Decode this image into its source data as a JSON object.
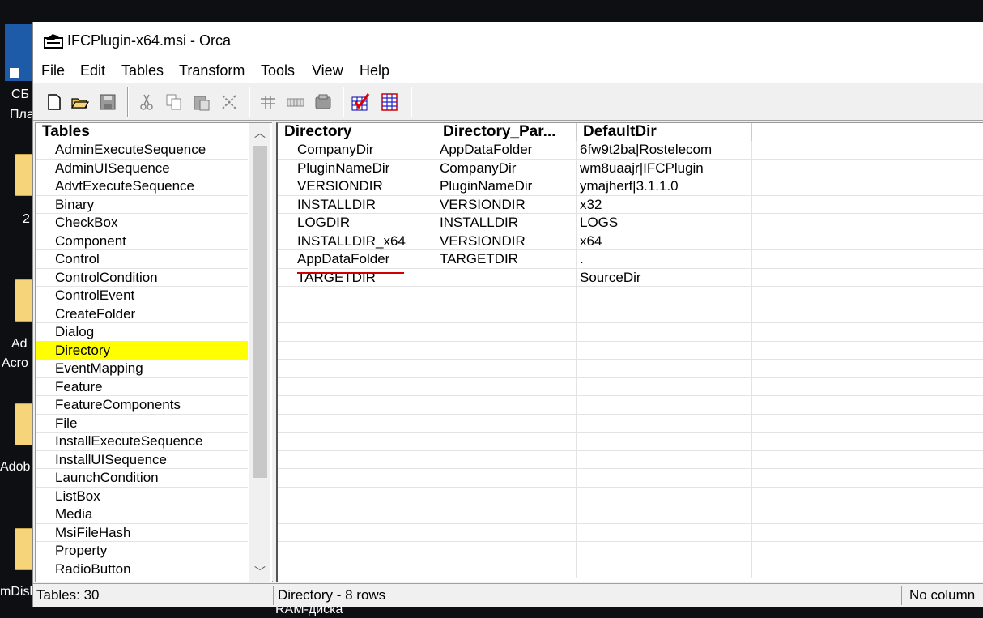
{
  "desktop": {
    "labels": [
      "СБ",
      "Пла",
      "2",
      "Ad",
      "Acro",
      "Adob",
      "mDisk"
    ],
    "taskbar_label": "RAM-диска"
  },
  "window": {
    "title": "IFCPlugin-x64.msi - Orca"
  },
  "menu": [
    "File",
    "Edit",
    "Tables",
    "Transform",
    "Tools",
    "View",
    "Help"
  ],
  "toolbar": {
    "icons": [
      "new-icon",
      "open-icon",
      "save-icon",
      "cut-icon",
      "copy-icon",
      "paste-icon",
      "delete-icon",
      "table-icon-1",
      "table-icon-2",
      "table-icon-3",
      "validate-icon",
      "grid-icon"
    ]
  },
  "tables_panel": {
    "header": "Tables",
    "items": [
      "AdminExecuteSequence",
      "AdminUISequence",
      "AdvtExecuteSequence",
      "Binary",
      "CheckBox",
      "Component",
      "Control",
      "ControlCondition",
      "ControlEvent",
      "CreateFolder",
      "Dialog",
      "Directory",
      "EventMapping",
      "Feature",
      "FeatureComponents",
      "File",
      "InstallExecuteSequence",
      "InstallUISequence",
      "LaunchCondition",
      "ListBox",
      "Media",
      "MsiFileHash",
      "Property",
      "RadioButton"
    ],
    "selected": "Directory",
    "selected_color": "#ffff00"
  },
  "grid": {
    "columns": [
      "Directory",
      "Directory_Par...",
      "DefaultDir"
    ],
    "rows": [
      [
        "CompanyDir",
        "AppDataFolder",
        "6fw9t2ba|Rostelecom"
      ],
      [
        "PluginNameDir",
        "CompanyDir",
        "wm8uaajr|IFCPlugin"
      ],
      [
        "VERSIONDIR",
        "PluginNameDir",
        "ymajherf|3.1.1.0"
      ],
      [
        "INSTALLDIR",
        "VERSIONDIR",
        "x32"
      ],
      [
        "LOGDIR",
        "INSTALLDIR",
        "LOGS"
      ],
      [
        "INSTALLDIR_x64",
        "VERSIONDIR",
        "x64"
      ],
      [
        "AppDataFolder",
        "TARGETDIR",
        "."
      ],
      [
        "TARGETDIR",
        "",
        "SourceDir"
      ]
    ],
    "highlight_color": "#d00000"
  },
  "status": {
    "tables_count": "Tables: 30",
    "table_info": "Directory - 8 rows",
    "column_info": "No column"
  }
}
